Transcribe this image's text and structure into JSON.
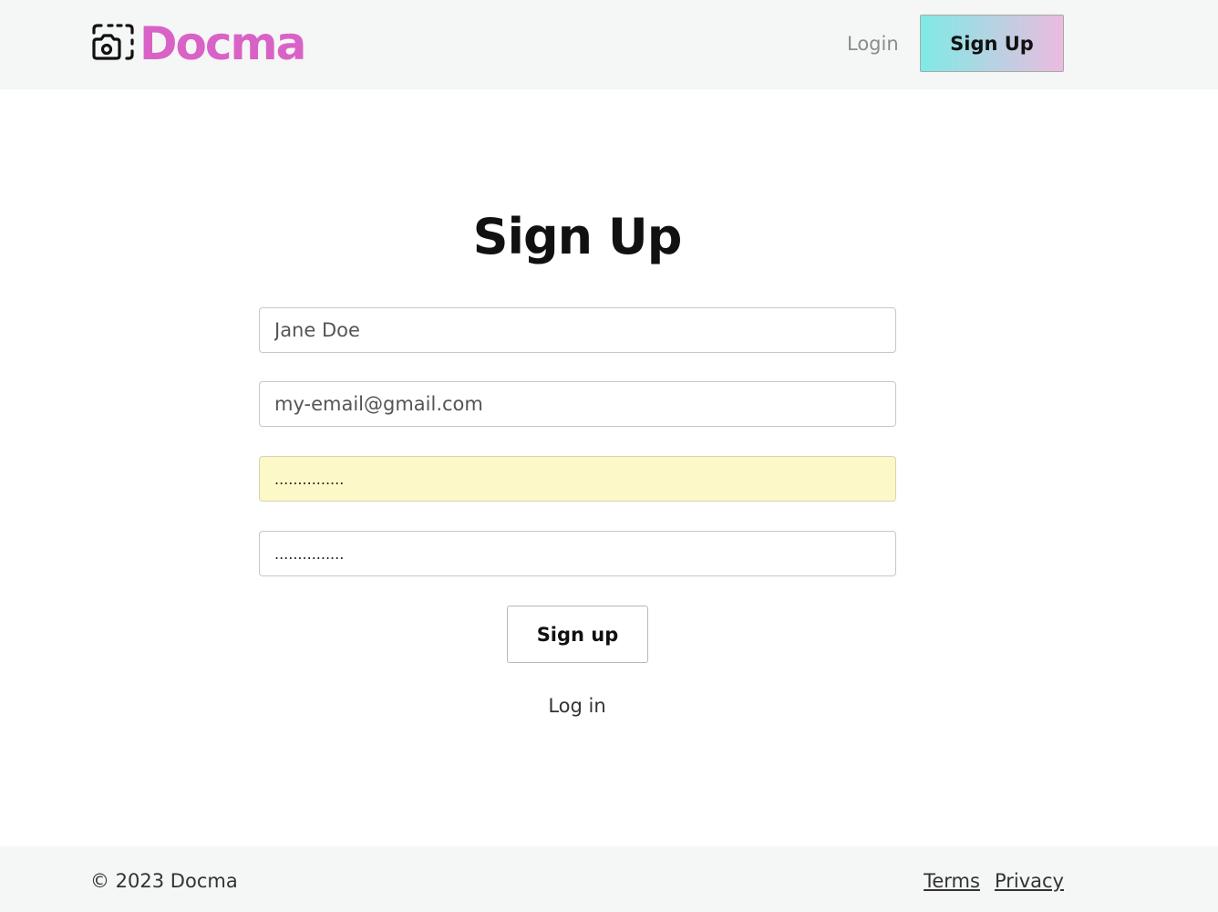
{
  "brand": {
    "name": "Docma",
    "icon": "camera-frame-icon",
    "color": "#d962c6"
  },
  "header": {
    "login_label": "Login",
    "signup_label": "Sign Up"
  },
  "form": {
    "title": "Sign Up",
    "name_value": "Jane Doe",
    "email_value": "my-email@gmail.com",
    "password_value": "...............",
    "confirm_password_value": "...............",
    "submit_label": "Sign up",
    "login_link_label": "Log in"
  },
  "footer": {
    "copyright": "© 2023 Docma",
    "links": [
      "Terms",
      "Privacy"
    ]
  },
  "colors": {
    "header_bg": "#f5f6f6",
    "autofill_bg": "#fcf8c7",
    "signup_gradient_start": "#7feae5",
    "signup_gradient_end": "#ebbbe0"
  }
}
